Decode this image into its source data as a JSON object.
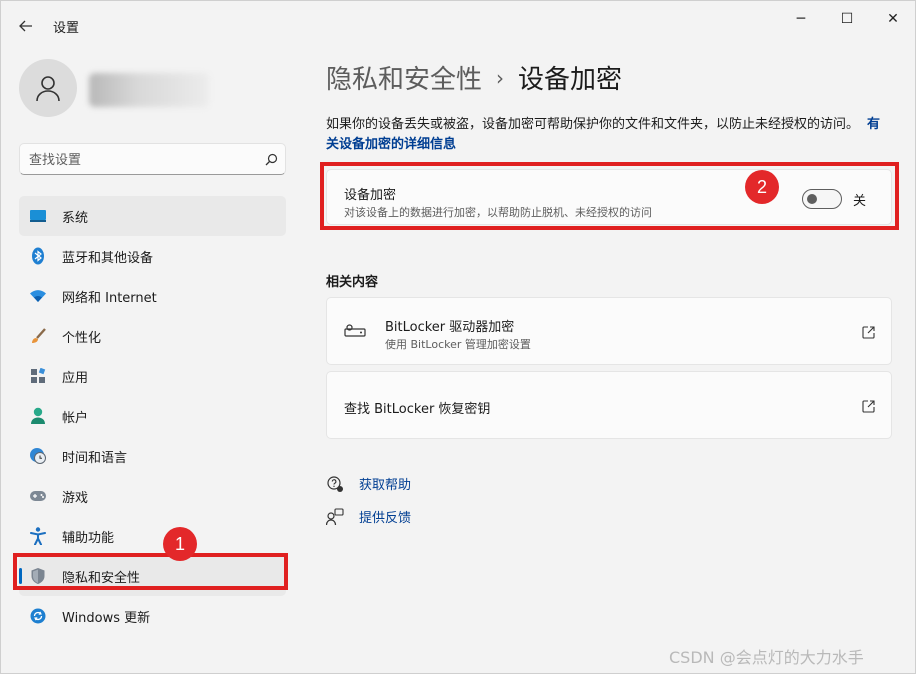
{
  "window": {
    "app_title": "设置",
    "back_icon": "back-arrow-icon",
    "controls": {
      "minimize": "─",
      "maximize": "☐",
      "close": "✕"
    }
  },
  "sidebar": {
    "search": {
      "placeholder": "查找设置"
    },
    "items": [
      {
        "label": "系统",
        "icon": "system-display-icon"
      },
      {
        "label": "蓝牙和其他设备",
        "icon": "bluetooth-icon"
      },
      {
        "label": "网络和 Internet",
        "icon": "wifi-icon"
      },
      {
        "label": "个性化",
        "icon": "paintbrush-icon"
      },
      {
        "label": "应用",
        "icon": "apps-icon"
      },
      {
        "label": "帐户",
        "icon": "account-icon"
      },
      {
        "label": "时间和语言",
        "icon": "clock-globe-icon"
      },
      {
        "label": "游戏",
        "icon": "gamepad-icon"
      },
      {
        "label": "辅助功能",
        "icon": "accessibility-icon"
      },
      {
        "label": "隐私和安全性",
        "icon": "shield-icon"
      },
      {
        "label": "Windows 更新",
        "icon": "windows-update-icon"
      }
    ]
  },
  "main": {
    "breadcrumb": {
      "parent": "隐私和安全性",
      "separator": "›",
      "current": "设备加密"
    },
    "description": "如果你的设备丢失或被盗，设备加密可帮助保护你的文件和文件夹，以防止未经授权的访问。",
    "description_link": "有关设备加密的详细信息",
    "encryption_card": {
      "title": "设备加密",
      "subtitle": "对该设备上的数据进行加密，以帮助防止脱机、未经授权的访问",
      "toggle_state": "关",
      "toggle_on": false
    },
    "related_title": "相关内容",
    "bitlocker_card": {
      "title": "BitLocker 驱动器加密",
      "subtitle": "使用 BitLocker 管理加密设置"
    },
    "recover_card": {
      "title": "查找 BitLocker 恢复密钥"
    },
    "help_links": [
      {
        "label": "获取帮助",
        "icon": "help-icon"
      },
      {
        "label": "提供反馈",
        "icon": "feedback-icon"
      }
    ]
  },
  "annotations": {
    "badge_1": "1",
    "badge_2": "2",
    "color": "#e02020"
  },
  "watermark": "CSDN @会点灯的大力水手",
  "colors": {
    "accent": "#0067c0",
    "link": "#003e92",
    "background": "#f3f3f3",
    "card": "#fbfbfb"
  }
}
